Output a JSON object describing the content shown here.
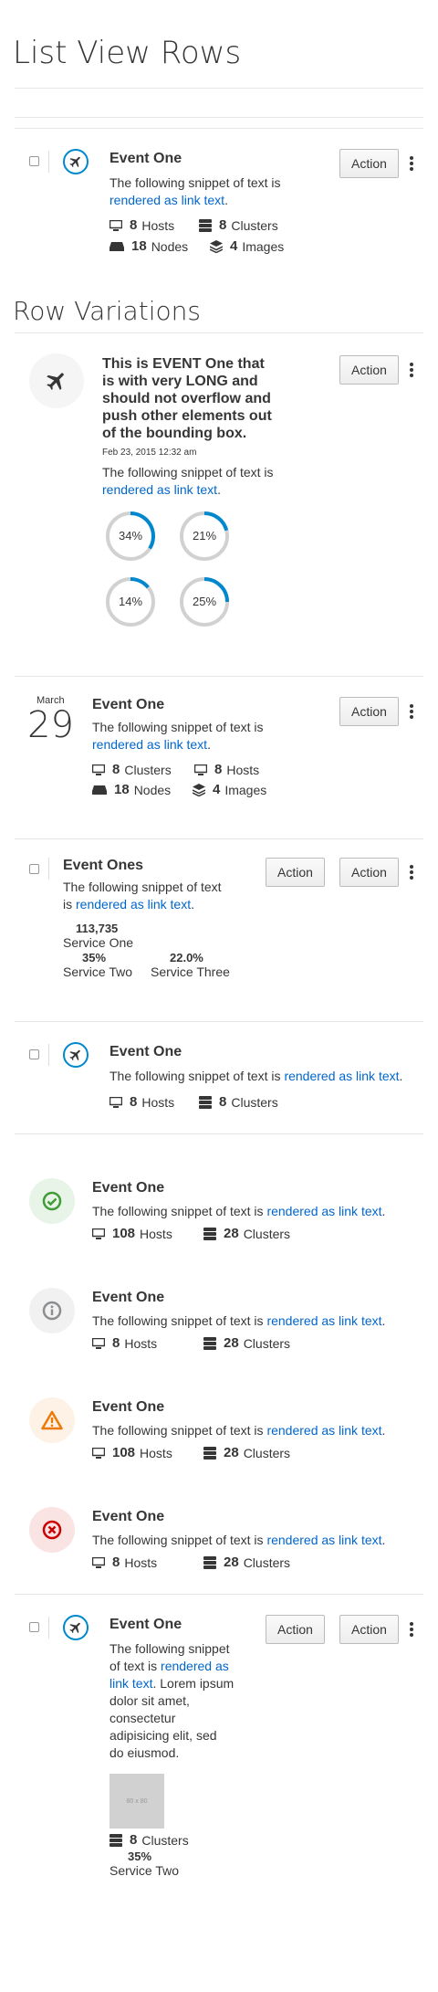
{
  "page_title": "List View Rows",
  "section_title": "Row Variations",
  "action_label": "Action",
  "snippet_text": "The following snippet of text is",
  "link_text": "rendered as link text",
  "period": ".",
  "labels": {
    "hosts": "Hosts",
    "clusters": "Clusters",
    "nodes": "Nodes",
    "images": "Images"
  },
  "row1": {
    "title": "Event One",
    "hosts": "8",
    "clusters": "8",
    "nodes": "18",
    "images": "4"
  },
  "row2": {
    "title": "This is EVENT One that is with very LONG and should not overflow and push other elements out of the bounding box.",
    "title_lines": [
      "This is EVENT One that",
      "is with very LONG and",
      "should not overflow and",
      "push other elements out",
      "of the bounding box."
    ],
    "date": "Feb 23, 2015 12:32 am",
    "donuts": [
      {
        "label": "34%",
        "value": 0.34
      },
      {
        "label": "21%",
        "value": 0.21
      },
      {
        "label": "14%",
        "value": 0.14
      },
      {
        "label": "25%",
        "value": 0.25
      }
    ]
  },
  "row3": {
    "month": "March",
    "day": "29",
    "title": "Event One",
    "clusters": "8",
    "hosts": "8",
    "nodes": "18",
    "images": "4"
  },
  "row4": {
    "title": "Event Ones",
    "snippet_line1": "The following snippet of text",
    "snippet_line2": "is",
    "services": [
      {
        "value": "113,735",
        "name": "Service One"
      },
      {
        "value": "35%",
        "name": "Service Two"
      },
      {
        "value": "22.0%",
        "name": "Service Three"
      }
    ]
  },
  "row5": {
    "title": "Event One",
    "hosts": "8",
    "clusters": "8"
  },
  "status_rows": [
    {
      "title": "Event One",
      "hosts": "108",
      "clusters": "28",
      "status": "ok",
      "icon": "check-circle-icon",
      "color": "#3f9c35",
      "bg": "#e9f4e9"
    },
    {
      "title": "Event One",
      "hosts": "8",
      "clusters": "28",
      "status": "info",
      "icon": "info-circle-icon",
      "color": "#8b8d8f",
      "bg": "#f1f1f1"
    },
    {
      "title": "Event One",
      "hosts": "108",
      "clusters": "28",
      "status": "warning",
      "icon": "warning-triangle-icon",
      "color": "#ec7a08",
      "bg": "#fdf2e5"
    },
    {
      "title": "Event One",
      "hosts": "8",
      "clusters": "28",
      "status": "error",
      "icon": "error-circle-icon",
      "color": "#cc0000",
      "bg": "#fae3e3"
    }
  ],
  "row10": {
    "title": "Event One",
    "body_lines": [
      "The following snippet",
      "of text is",
      "rendered as",
      "link text",
      ". Lorem ipsum",
      "dolor sit amet,",
      "consectetur",
      "adipisicing elit, sed",
      "do eiusmod."
    ],
    "thumb_label": "80 x 80",
    "clusters": "8",
    "service_value": "35%",
    "service_name": "Service Two"
  },
  "colors": {
    "accent": "#0088ce",
    "link": "#0066cc",
    "text": "#363636"
  }
}
